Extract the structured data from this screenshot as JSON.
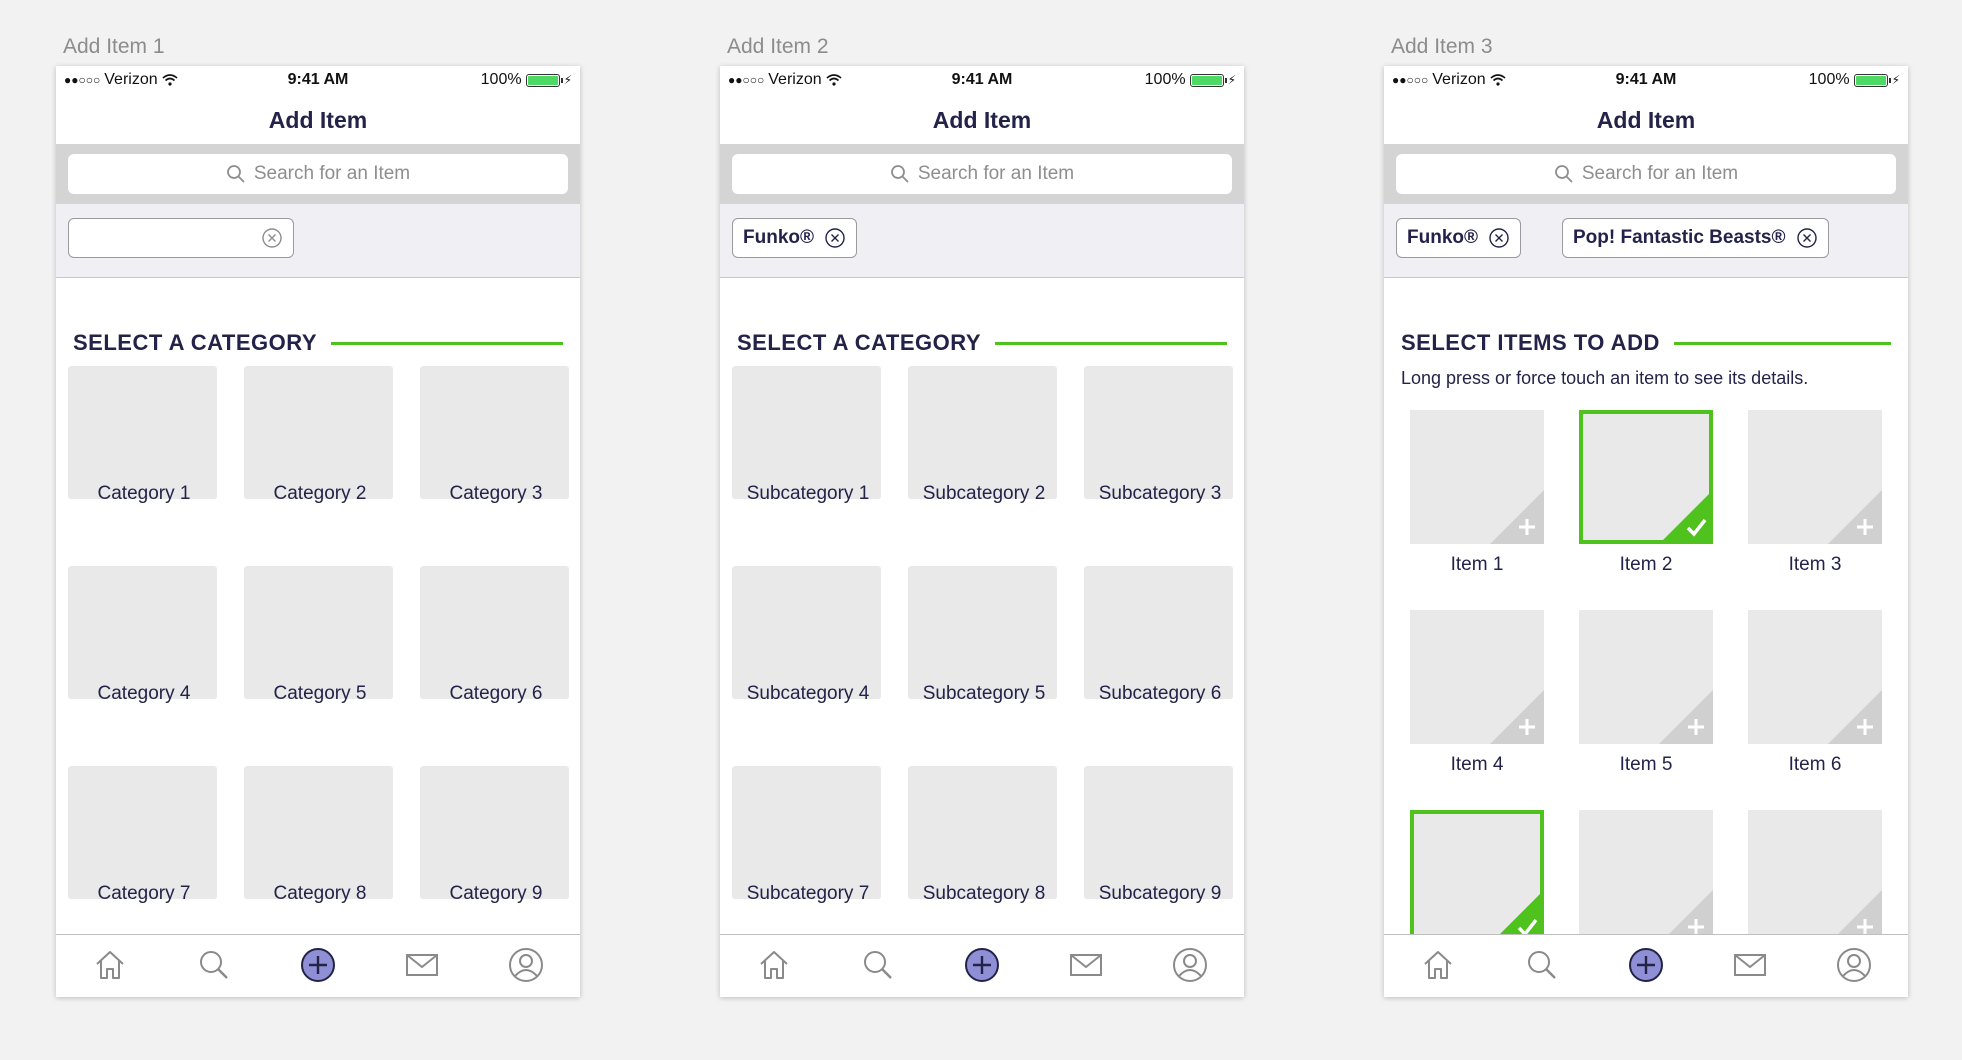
{
  "artboards": [
    {
      "label": "Add Item 1",
      "status": {
        "carrier": "Verizon",
        "time": "9:41 AM",
        "battery": "100%"
      },
      "title": "Add Item",
      "search_placeholder": "Search for an Item",
      "section_title": "SELECT A CATEGORY",
      "chips": [],
      "tiles": [
        "Category 1",
        "Category 2",
        "Category 3",
        "Category 4",
        "Category 5",
        "Category 6",
        "Category 7",
        "Category 8",
        "Category 9"
      ]
    },
    {
      "label": "Add Item 2",
      "status": {
        "carrier": "Verizon",
        "time": "9:41 AM",
        "battery": "100%"
      },
      "title": "Add Item",
      "search_placeholder": "Search for an Item",
      "section_title": "SELECT A CATEGORY",
      "chips": [
        "Funko®"
      ],
      "tiles": [
        "Subcategory 1",
        "Subcategory 2",
        "Subcategory 3",
        "Subcategory 4",
        "Subcategory 5",
        "Subcategory 6",
        "Subcategory 7",
        "Subcategory 8",
        "Subcategory 9"
      ]
    },
    {
      "label": "Add Item 3",
      "status": {
        "carrier": "Verizon",
        "time": "9:41 AM",
        "battery": "100%"
      },
      "title": "Add Item",
      "search_placeholder": "Search for an Item",
      "section_title": "SELECT ITEMS TO ADD",
      "hint": "Long press or force touch  an item to see its details.",
      "chips": [
        "Funko®",
        "Pop! Fantastic Beasts®"
      ],
      "items": [
        {
          "label": "Item 1",
          "selected": false
        },
        {
          "label": "Item 2",
          "selected": true
        },
        {
          "label": "Item 3",
          "selected": false
        },
        {
          "label": "Item 4",
          "selected": false
        },
        {
          "label": "Item 5",
          "selected": false
        },
        {
          "label": "Item 6",
          "selected": false
        },
        {
          "label": "",
          "selected": true
        },
        {
          "label": "",
          "selected": false
        },
        {
          "label": "",
          "selected": false
        }
      ]
    }
  ],
  "tabbar": [
    "home-icon",
    "search-icon",
    "add-icon",
    "mail-icon",
    "profile-icon"
  ],
  "colors": {
    "accent": "#4fc21e",
    "navy": "#23234a",
    "add_fill": "#8f8fd6"
  }
}
